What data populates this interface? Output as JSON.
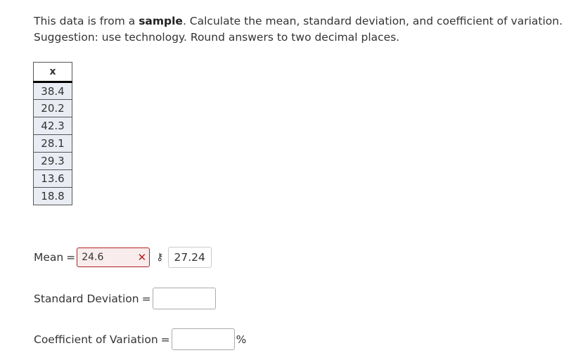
{
  "question": {
    "part1": "This data is from a ",
    "bold": "sample",
    "part2": ". Calculate the mean, standard deviation, and coefficient of variation.",
    "line2": "Suggestion: use technology. Round answers to two decimal places."
  },
  "table": {
    "header": "x",
    "values": [
      "38.4",
      "20.2",
      "42.3",
      "28.1",
      "29.3",
      "13.6",
      "18.8"
    ]
  },
  "mean": {
    "label": "Mean",
    "eq": "=",
    "entered_value": "24.6",
    "status_icon": "x-mark-icon",
    "key_icon": "key-icon",
    "correct_answer": "27.24"
  },
  "std": {
    "label": "Standard Deviation",
    "eq": "=",
    "value": ""
  },
  "cv": {
    "label": "Coefficient of Variation",
    "eq": "=",
    "value": "",
    "unit": "%"
  },
  "colors": {
    "error": "#b22222",
    "cell_bg": "#e9ecf3"
  }
}
